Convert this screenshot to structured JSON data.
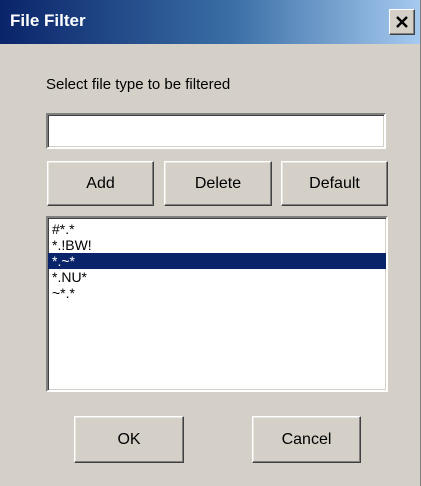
{
  "window": {
    "title": "File Filter",
    "close_icon": "close-x-icon"
  },
  "form": {
    "prompt_label": "Select file type to be filtered",
    "filter_input_value": "",
    "add_label": "Add",
    "delete_label": "Delete",
    "default_label": "Default"
  },
  "filters": {
    "items": [
      "#*.*",
      "*.!BW!",
      "*.~*",
      "*.NU*",
      "~*.*"
    ],
    "selected_index": 2
  },
  "footer": {
    "ok_label": "OK",
    "cancel_label": "Cancel"
  },
  "colors": {
    "title_gradient_start": "#0a246a",
    "title_gradient_end": "#a6caf0",
    "dialog_background": "#d4d0c8",
    "selection_background": "#0a246a"
  }
}
